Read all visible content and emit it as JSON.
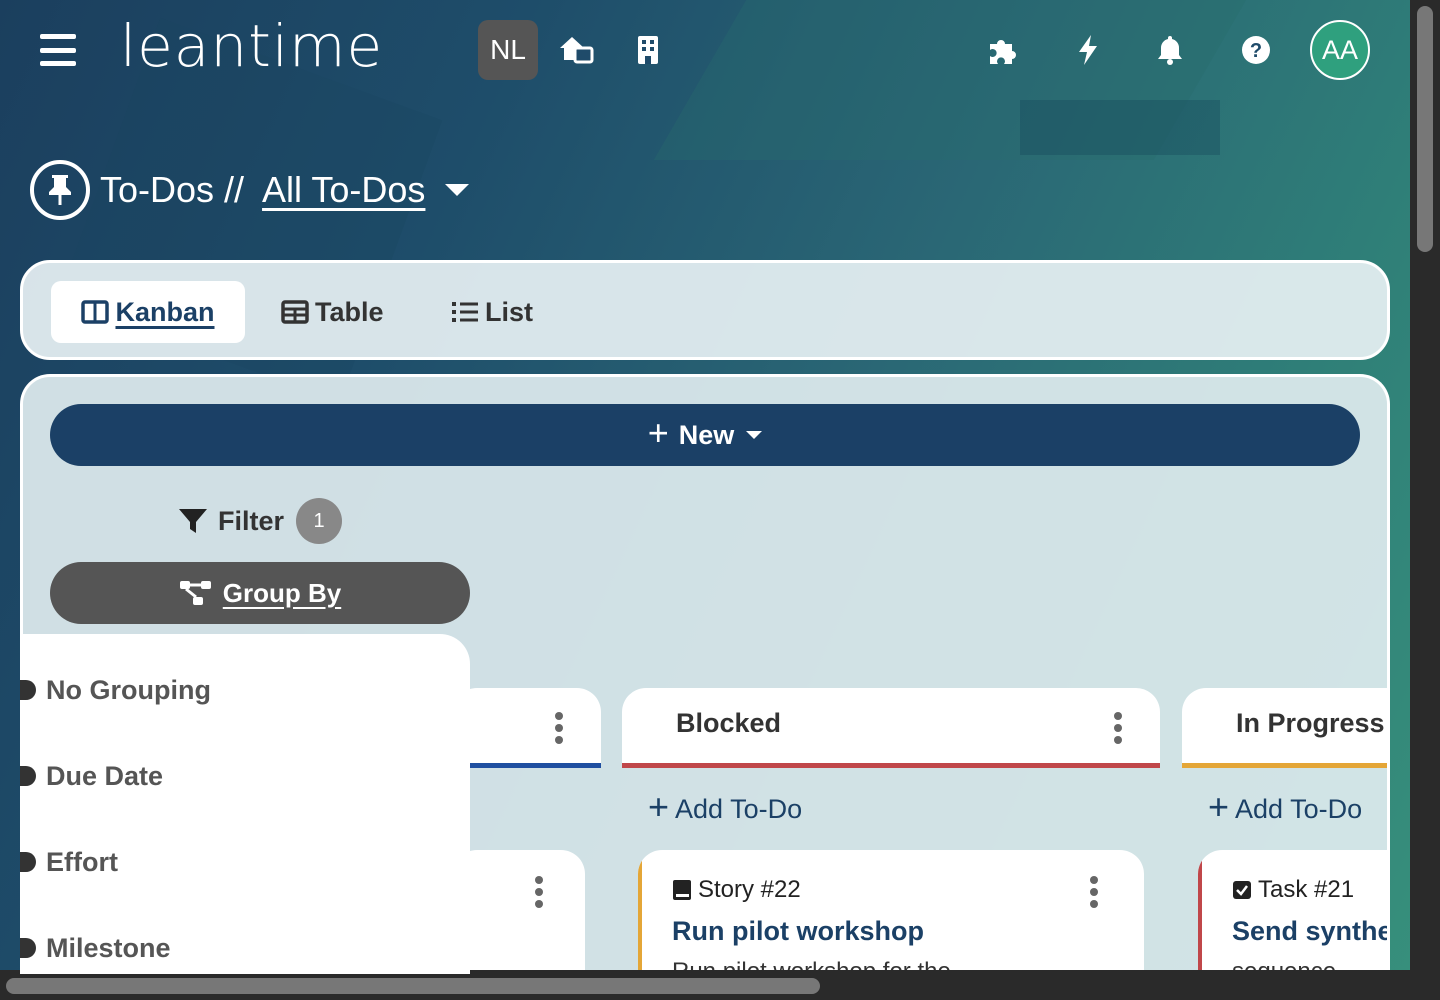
{
  "app": {
    "logo_text": "leantime",
    "project_badge": "NL",
    "user_initials": "AA"
  },
  "header_icons": [
    "menu-icon",
    "project-home-icon",
    "company-icon",
    "apps-icon",
    "lightning-icon",
    "bell-icon",
    "help-icon"
  ],
  "breadcrumb": {
    "section": "To-Dos //",
    "current": "All To-Dos"
  },
  "view_tabs": [
    {
      "label": "Kanban",
      "icon": "kanban-icon",
      "active": true
    },
    {
      "label": "Table",
      "icon": "table-icon",
      "active": false
    },
    {
      "label": "List",
      "icon": "list-icon",
      "active": false
    }
  ],
  "toolbar": {
    "new_label": "New",
    "filter_label": "Filter",
    "filter_count": "1",
    "group_by_label": "Group By"
  },
  "group_by_options": [
    "No Grouping",
    "Due Date",
    "Effort",
    "Milestone"
  ],
  "columns": [
    {
      "title": "",
      "color": "#1f4fa0"
    },
    {
      "title": "Blocked",
      "color": "#c0474a",
      "add_label": "Add To-Do"
    },
    {
      "title": "In Progress",
      "color": "#e4a637",
      "add_label": "Add To-Do"
    }
  ],
  "cards": [
    {
      "type": "Story #22",
      "title": "Run pilot workshop",
      "description": "Run pilot workshop for the",
      "accent": "#e4a637"
    },
    {
      "type": "Task #21",
      "title": "Send synthe",
      "description": "sequence",
      "accent": "#c0474a"
    }
  ],
  "colors": {
    "primary": "#1b4066",
    "group_by_bg": "#555555"
  }
}
